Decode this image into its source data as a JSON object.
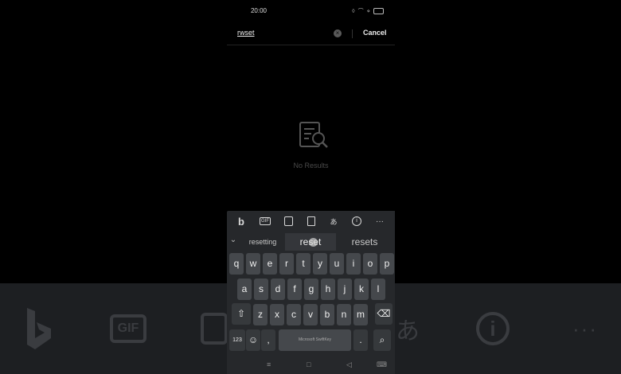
{
  "status": {
    "time": "20:00"
  },
  "search": {
    "query": "rwset",
    "clear_icon": "×",
    "cancel_label": "Cancel"
  },
  "empty_state": {
    "message": "No Results",
    "icon": "search-document-icon"
  },
  "keyboard": {
    "toolbar": {
      "gif_label": "GIF",
      "translate_label": "あ",
      "more_label": "···"
    },
    "suggestions": {
      "left": "resetting",
      "center": "reset",
      "right": "resets"
    },
    "rows": [
      [
        "q",
        "w",
        "e",
        "r",
        "t",
        "y",
        "u",
        "i",
        "o",
        "p"
      ],
      [
        "a",
        "s",
        "d",
        "f",
        "g",
        "h",
        "j",
        "k",
        "l"
      ],
      [
        "z",
        "x",
        "c",
        "v",
        "b",
        "n",
        "m"
      ]
    ],
    "numbers_label": "123",
    "comma_label": ",",
    "period_label": ".",
    "space_label": "Microsoft SwiftKey"
  },
  "colors": {
    "background": "#000000",
    "keyboard": "#26282b",
    "key": "#45484c"
  }
}
